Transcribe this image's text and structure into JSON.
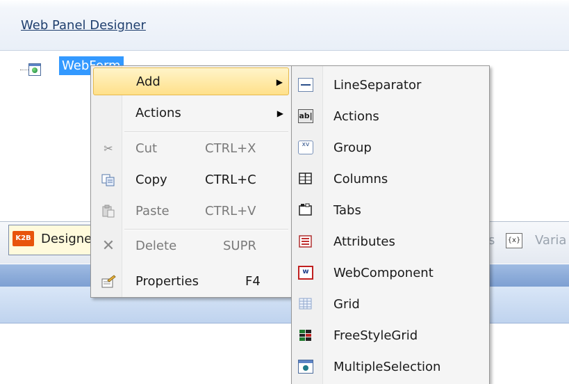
{
  "header": {
    "title": "Web Panel Designer"
  },
  "tree": {
    "node_label": "WebForm"
  },
  "tabs": {
    "designer_label": "Designe",
    "k2b_icon_text": "K2B",
    "partial_tab_suffix": "s",
    "variables_label": "Varia"
  },
  "context_menu": {
    "items": [
      {
        "label": "Add",
        "submenu": true,
        "highlighted": true
      },
      {
        "label": "Actions",
        "submenu": true
      },
      {
        "label": "Cut",
        "shortcut": "CTRL+X",
        "disabled": true,
        "icon": "scissors-icon"
      },
      {
        "label": "Copy",
        "shortcut": "CTRL+C",
        "disabled": false,
        "icon": "copy-icon"
      },
      {
        "label": "Paste",
        "shortcut": "CTRL+V",
        "disabled": true,
        "icon": "paste-icon"
      },
      {
        "label": "Delete",
        "shortcut": "SUPR",
        "disabled": true,
        "icon": "delete-icon"
      },
      {
        "label": "Properties",
        "shortcut": "F4",
        "disabled": false,
        "icon": "properties-icon"
      }
    ]
  },
  "add_submenu": {
    "items": [
      {
        "label": "LineSeparator",
        "icon": "line-separator-icon"
      },
      {
        "label": "Actions",
        "icon": "actions-icon",
        "icon_text": "ab|"
      },
      {
        "label": "Group",
        "icon": "group-icon",
        "icon_text": "xv"
      },
      {
        "label": "Columns",
        "icon": "columns-icon"
      },
      {
        "label": "Tabs",
        "icon": "tabs-icon"
      },
      {
        "label": "Attributes",
        "icon": "attributes-icon"
      },
      {
        "label": "WebComponent",
        "icon": "webcomponent-icon",
        "icon_text": "w"
      },
      {
        "label": "Grid",
        "icon": "grid-icon"
      },
      {
        "label": "FreeStyleGrid",
        "icon": "freestylegrid-icon"
      },
      {
        "label": "MultipleSelection",
        "icon": "multiple-selection-icon"
      }
    ]
  },
  "colors": {
    "selection": "#3399ff",
    "highlight": "#ffe08a",
    "header_link": "#1f3f6e",
    "k2b_orange": "#e8540c"
  }
}
